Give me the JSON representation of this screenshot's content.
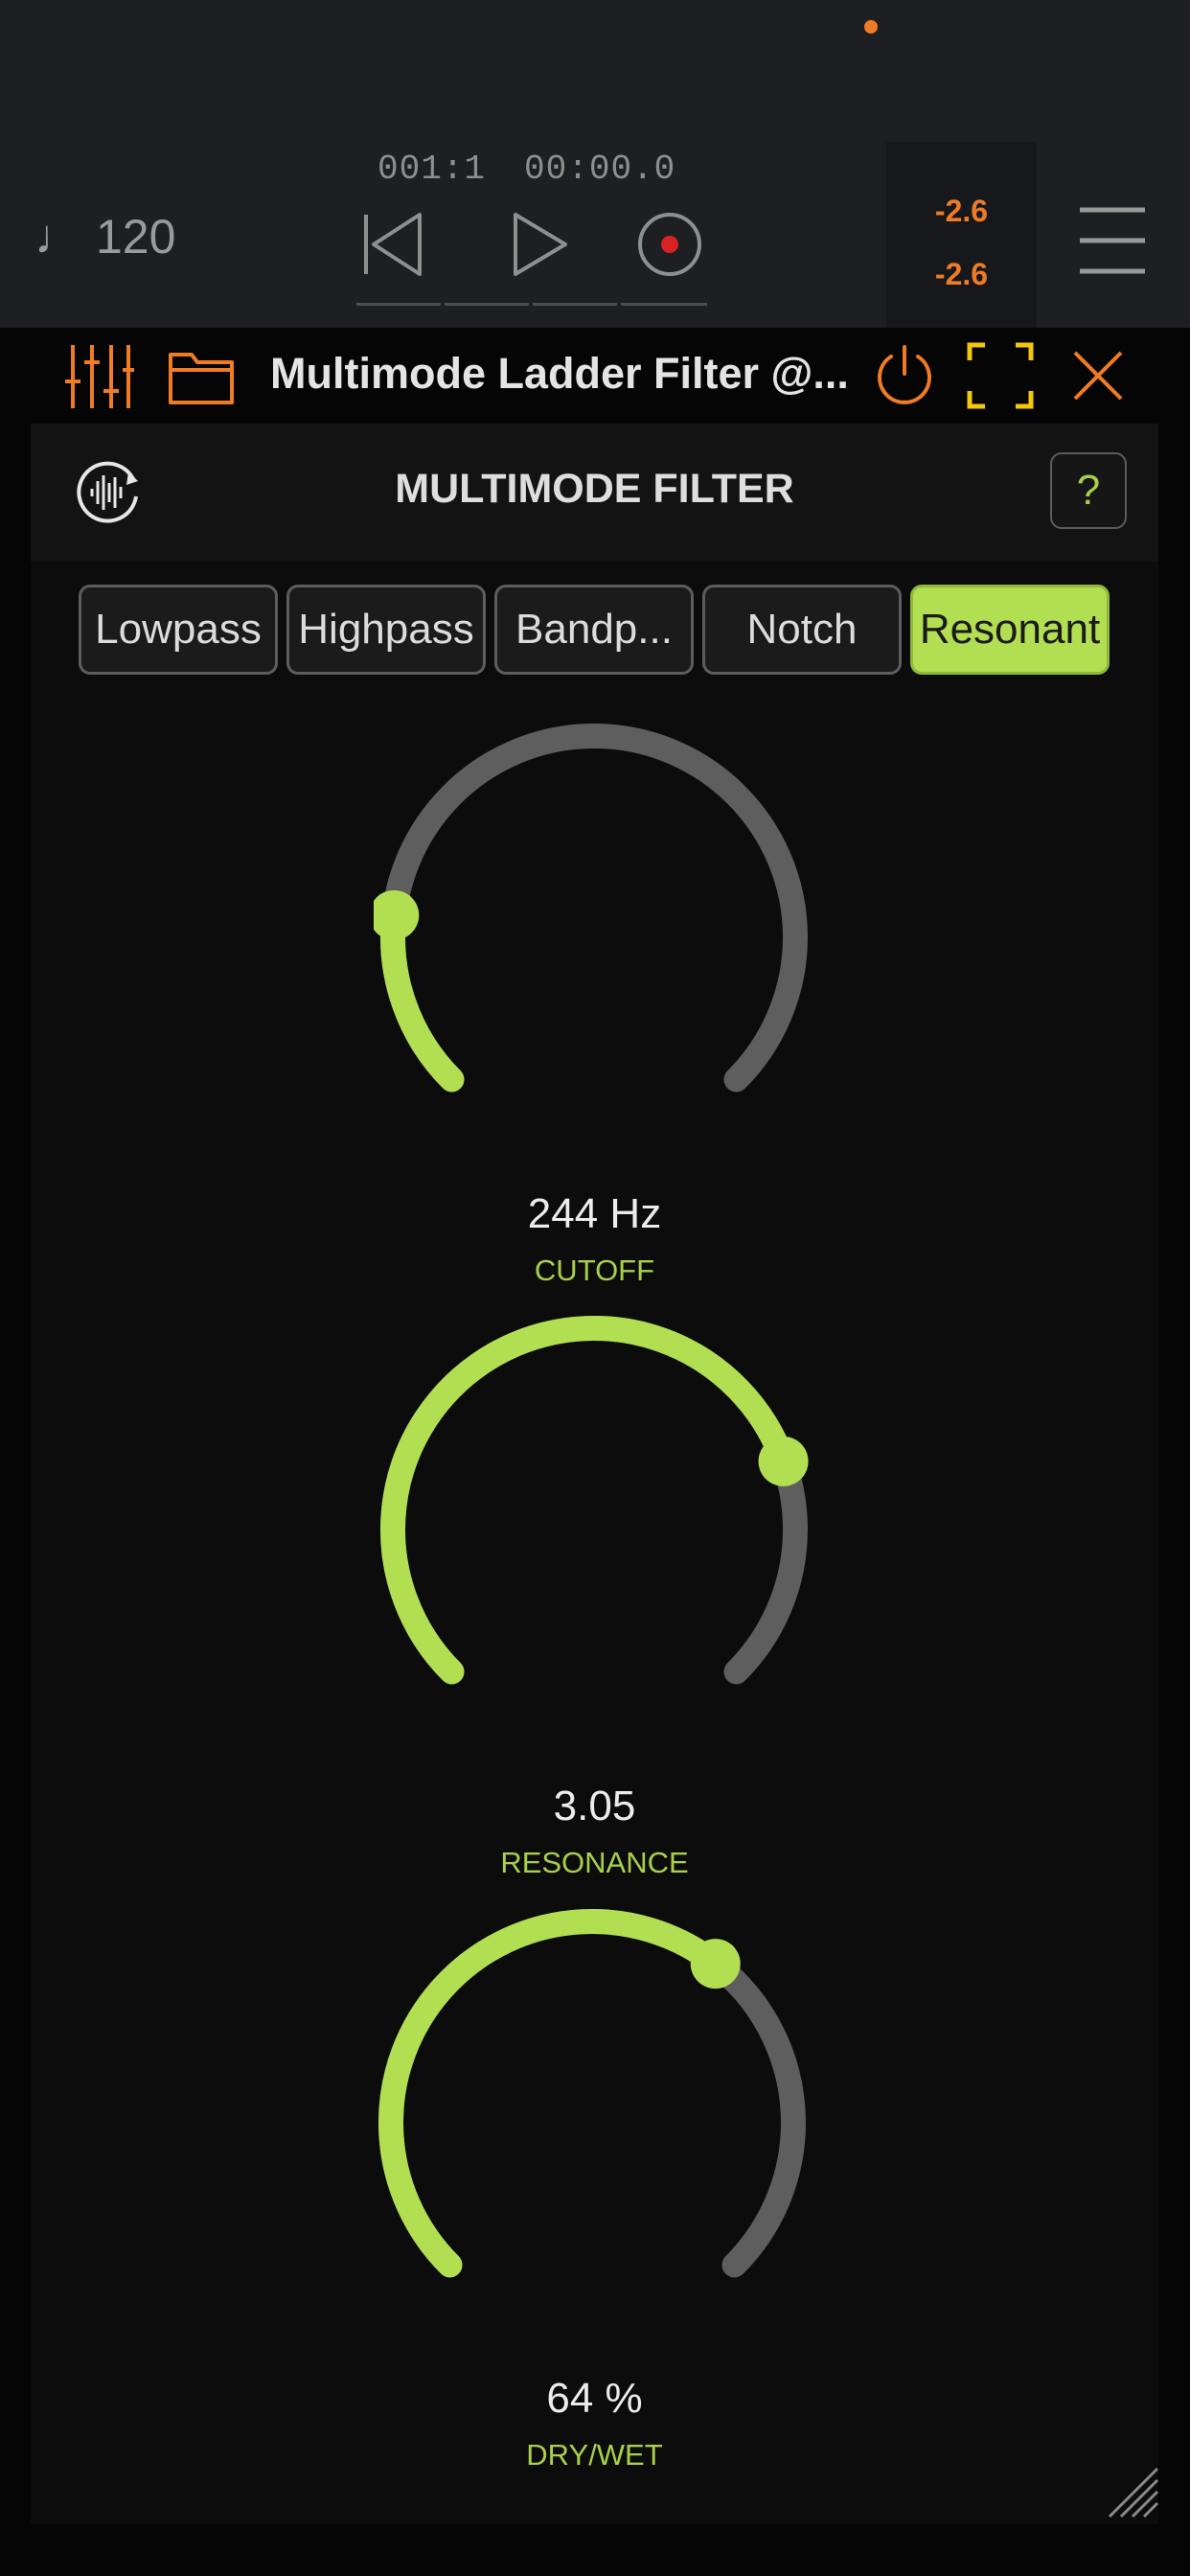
{
  "colors": {
    "accent": "#b2df52",
    "label_green": "#a9d04a",
    "orange": "#f07b25",
    "yellow": "#f2c80f",
    "track": "#5e5e5e",
    "record_red": "#d92323"
  },
  "header": {
    "tempo": "120",
    "bar_beat": "001:1",
    "time": "00:00.0",
    "meter_levels": [
      "-2.6",
      "-2.6"
    ]
  },
  "icons": {
    "note": "music-note-icon",
    "rewind": "skip-back-icon",
    "play": "play-icon",
    "record": "record-icon",
    "menu": "hamburger-menu-icon",
    "mixer": "mixer-sliders-icon",
    "folder": "folder-icon",
    "power": "power-icon",
    "fullscreen": "fullscreen-icon",
    "close": "close-icon",
    "waveform": "waveform-refresh-icon",
    "resize": "resize-handle-icon"
  },
  "plugin": {
    "title": "Multimode Ladder Filter @...",
    "panel_title": "MULTIMODE FILTER",
    "help_label": "?",
    "modes": [
      "Lowpass",
      "Highpass",
      "Bandp...",
      "Notch",
      "Resonant"
    ],
    "selected_mode": "Resonant",
    "knobs": [
      {
        "label": "CUTOFF",
        "value": "244 Hz",
        "level": 0.19
      },
      {
        "label": "RESONANCE",
        "value": "3.05",
        "level": 0.76
      },
      {
        "label": "DRY/WET",
        "value": "64 %",
        "level": 0.64
      }
    ]
  }
}
